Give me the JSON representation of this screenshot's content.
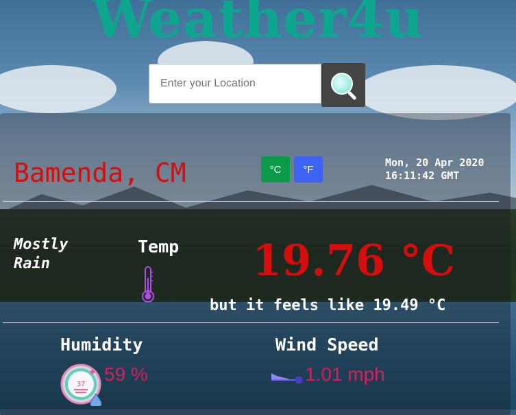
{
  "app": {
    "title": "Weather4u"
  },
  "search": {
    "placeholder": "Enter your Location",
    "button_icon": "search-icon"
  },
  "location": {
    "name": "Bamenda, CM"
  },
  "units": {
    "celsius_label": "°C",
    "fahrenheit_label": "°F",
    "celsius_color": "#0c9b48",
    "fahrenheit_color": "#3c63f2"
  },
  "datetime": {
    "text": "Mon, 20 Apr 2020 16:11:42 GMT"
  },
  "current": {
    "condition": "Mostly Rain",
    "temp_label": "Temp",
    "temp_value": "19.76 °C",
    "feels_like": "but it feels like 19.49 °C"
  },
  "humidity": {
    "label": "Humidity",
    "value": "59 %",
    "gauge_text": "37",
    "icon": "humidity-gauge-icon"
  },
  "wind": {
    "label": "Wind Speed",
    "value": "1.01 mph",
    "icon": "wind-icon"
  },
  "colors": {
    "title": "#0fa68f",
    "accent_red": "#d40d0d",
    "value_pink": "#d6205a"
  }
}
